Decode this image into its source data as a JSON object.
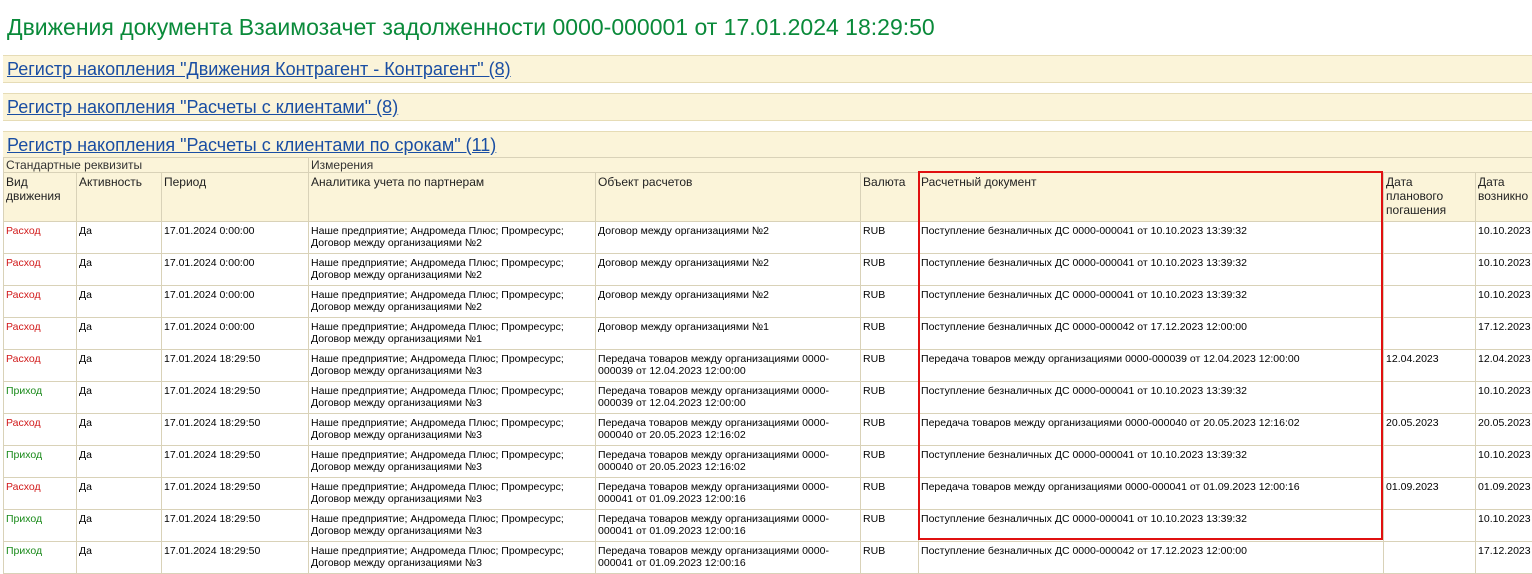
{
  "title": "Движения документа Взаимозачет задолженности 0000-000001 от 17.01.2024 18:29:50",
  "sections": [
    {
      "label": "Регистр накопления \"Движения Контрагент - Контрагент\" (8)"
    },
    {
      "label": "Регистр накопления \"Расчеты с клиентами\" (8)"
    },
    {
      "label": "Регистр накопления \"Расчеты с клиентами по срокам\" (11)"
    }
  ],
  "table": {
    "groups": {
      "standard": "Стандартные реквизиты",
      "dimensions": "Измерения"
    },
    "columns": {
      "kind": "Вид движения",
      "active": "Активность",
      "period": "Период",
      "analytics": "Аналитика учета по партнерам",
      "object": "Объект расчетов",
      "currency": "Валюта",
      "doc": "Расчетный документ",
      "plan_date": "Дата планового погашения",
      "origin_date": "Дата возникно"
    },
    "rows": [
      {
        "kind": "Расход",
        "active": "Да",
        "period": "17.01.2024 0:00:00",
        "analytics": "Наше предприятие; Андромеда Плюс; Промресурс; Договор между организациями №2",
        "object": "Договор между организациями №2",
        "currency": "RUB",
        "doc": "Поступление безналичных ДС 0000-000041 от 10.10.2023 13:39:32",
        "plan_date": "",
        "origin_date": "10.10.2023"
      },
      {
        "kind": "Расход",
        "active": "Да",
        "period": "17.01.2024 0:00:00",
        "analytics": "Наше предприятие; Андромеда Плюс; Промресурс; Договор между организациями №2",
        "object": "Договор между организациями №2",
        "currency": "RUB",
        "doc": "Поступление безналичных ДС 0000-000041 от 10.10.2023 13:39:32",
        "plan_date": "",
        "origin_date": "10.10.2023"
      },
      {
        "kind": "Расход",
        "active": "Да",
        "period": "17.01.2024 0:00:00",
        "analytics": "Наше предприятие; Андромеда Плюс; Промресурс; Договор между организациями №2",
        "object": "Договор между организациями №2",
        "currency": "RUB",
        "doc": "Поступление безналичных ДС 0000-000041 от 10.10.2023 13:39:32",
        "plan_date": "",
        "origin_date": "10.10.2023"
      },
      {
        "kind": "Расход",
        "active": "Да",
        "period": "17.01.2024 0:00:00",
        "analytics": "Наше предприятие; Андромеда Плюс; Промресурс; Договор между организациями №1",
        "object": "Договор между организациями №1",
        "currency": "RUB",
        "doc": "Поступление безналичных ДС 0000-000042 от 17.12.2023 12:00:00",
        "plan_date": "",
        "origin_date": "17.12.2023"
      },
      {
        "kind": "Расход",
        "active": "Да",
        "period": "17.01.2024 18:29:50",
        "analytics": "Наше предприятие; Андромеда Плюс; Промресурс; Договор между организациями №3",
        "object": "Передача товаров между организациями 0000-000039 от 12.04.2023 12:00:00",
        "currency": "RUB",
        "doc": "Передача товаров между организациями 0000-000039 от 12.04.2023 12:00:00",
        "plan_date": "12.04.2023",
        "origin_date": "12.04.2023"
      },
      {
        "kind": "Приход",
        "active": "Да",
        "period": "17.01.2024 18:29:50",
        "analytics": "Наше предприятие; Андромеда Плюс; Промресурс; Договор между организациями №3",
        "object": "Передача товаров между организациями 0000-000039 от 12.04.2023 12:00:00",
        "currency": "RUB",
        "doc": "Поступление безналичных ДС 0000-000041 от 10.10.2023 13:39:32",
        "plan_date": "",
        "origin_date": "10.10.2023"
      },
      {
        "kind": "Расход",
        "active": "Да",
        "period": "17.01.2024 18:29:50",
        "analytics": "Наше предприятие; Андромеда Плюс; Промресурс; Договор между организациями №3",
        "object": "Передача товаров между организациями 0000-000040 от 20.05.2023 12:16:02",
        "currency": "RUB",
        "doc": "Передача товаров между организациями 0000-000040 от 20.05.2023 12:16:02",
        "plan_date": "20.05.2023",
        "origin_date": "20.05.2023"
      },
      {
        "kind": "Приход",
        "active": "Да",
        "period": "17.01.2024 18:29:50",
        "analytics": "Наше предприятие; Андромеда Плюс; Промресурс; Договор между организациями №3",
        "object": "Передача товаров между организациями 0000-000040 от 20.05.2023 12:16:02",
        "currency": "RUB",
        "doc": "Поступление безналичных ДС 0000-000041 от 10.10.2023 13:39:32",
        "plan_date": "",
        "origin_date": "10.10.2023"
      },
      {
        "kind": "Расход",
        "active": "Да",
        "period": "17.01.2024 18:29:50",
        "analytics": "Наше предприятие; Андромеда Плюс; Промресурс; Договор между организациями №3",
        "object": "Передача товаров между организациями 0000-000041 от 01.09.2023 12:00:16",
        "currency": "RUB",
        "doc": "Передача товаров между организациями 0000-000041 от 01.09.2023 12:00:16",
        "plan_date": "01.09.2023",
        "origin_date": "01.09.2023"
      },
      {
        "kind": "Приход",
        "active": "Да",
        "period": "17.01.2024 18:29:50",
        "analytics": "Наше предприятие; Андромеда Плюс; Промресурс; Договор между организациями №3",
        "object": "Передача товаров между организациями 0000-000041 от 01.09.2023 12:00:16",
        "currency": "RUB",
        "doc": "Поступление безналичных ДС 0000-000041 от 10.10.2023 13:39:32",
        "plan_date": "",
        "origin_date": "10.10.2023"
      },
      {
        "kind": "Приход",
        "active": "Да",
        "period": "17.01.2024 18:29:50",
        "analytics": "Наше предприятие; Андромеда Плюс; Промресурс; Договор между организациями №3",
        "object": "Передача товаров между организациями 0000-000041 от 01.09.2023 12:00:16",
        "currency": "RUB",
        "doc": "Поступление безналичных ДС 0000-000042 от 17.12.2023 12:00:00",
        "plan_date": "",
        "origin_date": "17.12.2023"
      }
    ]
  },
  "colors": {
    "title": "#0a8a3a",
    "link": "#1a4ea3",
    "header_bg": "#fbf4d9",
    "expense": "#d11a1a",
    "income": "#1a8a1a",
    "highlight": "#e01010"
  }
}
